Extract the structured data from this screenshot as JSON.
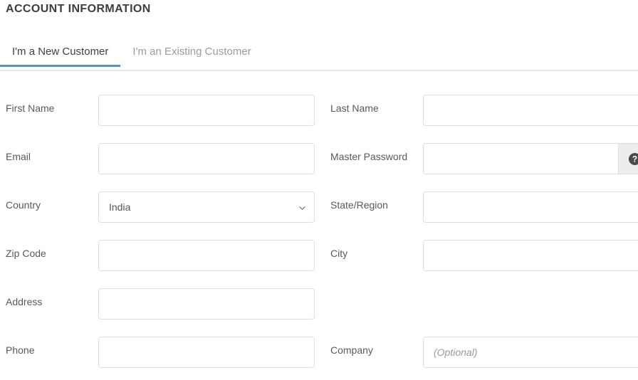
{
  "heading": "ACCOUNT INFORMATION",
  "tabs": [
    {
      "label": "I'm a New Customer",
      "active": true
    },
    {
      "label": "I'm an Existing Customer",
      "active": false
    }
  ],
  "colors": {
    "active_tab_underline": "#3d9bd8",
    "active_tab_text": "#3f3f3f",
    "inactive_tab_text": "#9a9a9a",
    "heading_text": "#3d3d3d",
    "label_text": "#59595b",
    "input_border": "#dededf",
    "addon_background": "#ededed",
    "placeholder_text": "#999999",
    "tab_strip_border": "#e6e6e6"
  },
  "form": {
    "rows": [
      {
        "left": {
          "label": "First Name",
          "type": "text",
          "value": "",
          "placeholder": ""
        },
        "right": {
          "label": "Last Name",
          "type": "text",
          "value": "",
          "placeholder": ""
        }
      },
      {
        "left": {
          "label": "Email",
          "type": "text",
          "value": "",
          "placeholder": ""
        },
        "right": {
          "label": "Master Password",
          "type": "password",
          "value": "",
          "placeholder": "",
          "addon_icon": "help-circle-icon"
        }
      },
      {
        "left": {
          "label": "Country",
          "type": "select",
          "value": "India",
          "options": [
            "India"
          ],
          "icon": "chevron-down-icon"
        },
        "right": {
          "label": "State/Region",
          "type": "text",
          "value": "",
          "placeholder": ""
        }
      },
      {
        "left": {
          "label": "Zip Code",
          "type": "text",
          "value": "",
          "placeholder": ""
        },
        "right": {
          "label": "City",
          "type": "text",
          "value": "",
          "placeholder": ""
        }
      },
      {
        "left": {
          "label": "Address",
          "type": "text",
          "value": "",
          "placeholder": ""
        },
        "right": null
      },
      {
        "left": {
          "label": "Phone",
          "type": "text",
          "value": "",
          "placeholder": ""
        },
        "right": {
          "label": "Company",
          "type": "text",
          "value": "",
          "placeholder": "(Optional)"
        }
      }
    ]
  }
}
